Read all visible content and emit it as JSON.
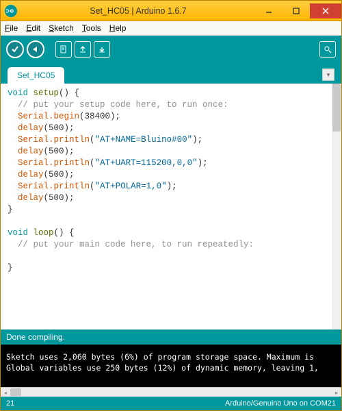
{
  "titlebar": {
    "text": "Set_HC05 | Arduino 1.6.7"
  },
  "menubar": {
    "file": "File",
    "edit": "Edit",
    "sketch": "Sketch",
    "tools": "Tools",
    "help": "Help"
  },
  "tabs": {
    "active": "Set_HC05"
  },
  "code": {
    "l1_kw": "void",
    "l1_fn": "setup",
    "l1_rest": "() {",
    "l2": "  // put your setup code here, to run once:",
    "l3_obj": "Serial",
    "l3_m": ".begin",
    "l3_rest": "(38400);",
    "l4_fn": "delay",
    "l4_rest": "(500);",
    "l5_obj": "Serial",
    "l5_m": ".println",
    "l5_s": "\"AT+NAME=Bluino#00\"",
    "l5_rest1": "(",
    "l5_rest2": ");",
    "l6_fn": "delay",
    "l6_rest": "(500);",
    "l7_obj": "Serial",
    "l7_m": ".println",
    "l7_s": "\"AT+UART=115200,0,0\"",
    "l7_rest1": "(",
    "l7_rest2": ");",
    "l8_fn": "delay",
    "l8_rest": "(500);",
    "l9_obj": "Serial",
    "l9_m": ".println",
    "l9_s": "\"AT+POLAR=1,0\"",
    "l9_rest1": "(",
    "l9_rest2": ");",
    "l10_fn": "delay",
    "l10_rest": "(500);",
    "l11": "}",
    "l12": "",
    "l13_kw": "void",
    "l13_fn": "loop",
    "l13_rest": "() {",
    "l14": "  // put your main code here, to run repeatedly:",
    "l15": "",
    "l16": "}"
  },
  "status": {
    "text": "Done compiling."
  },
  "console": {
    "line1": "Sketch uses 2,060 bytes (6%) of program storage space. Maximum is ",
    "line2": "Global variables use 250 bytes (12%) of dynamic memory, leaving 1,"
  },
  "footer": {
    "line": "21",
    "board": "Arduino/Genuino Uno on COM21"
  }
}
